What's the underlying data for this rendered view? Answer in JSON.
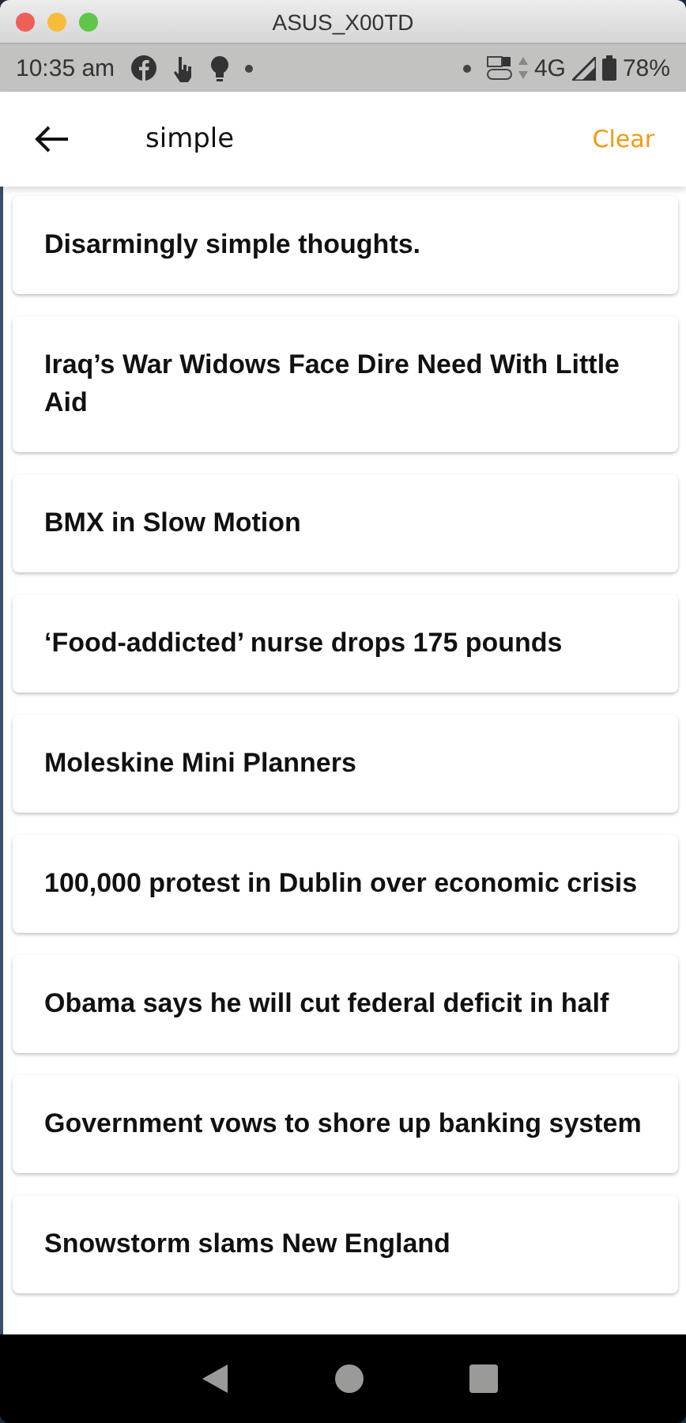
{
  "window": {
    "title": "ASUS_X00TD"
  },
  "status_bar": {
    "time": "10:35 am",
    "network": "4G",
    "battery": "78%"
  },
  "search": {
    "value": "simple",
    "clear": "Clear"
  },
  "results": [
    {
      "title": "Disarmingly simple thoughts."
    },
    {
      "title": "Iraq’s War Widows Face Dire Need With Little Aid"
    },
    {
      "title": "BMX in Slow Motion"
    },
    {
      "title": "‘Food-addicted’ nurse drops 175 pounds"
    },
    {
      "title": "Moleskine Mini Planners"
    },
    {
      "title": "100,000 protest in Dublin over economic crisis"
    },
    {
      "title": "Obama says he will cut federal deficit in half"
    },
    {
      "title": "Government vows to shore up banking system"
    },
    {
      "title": "Snowstorm slams New England"
    }
  ]
}
